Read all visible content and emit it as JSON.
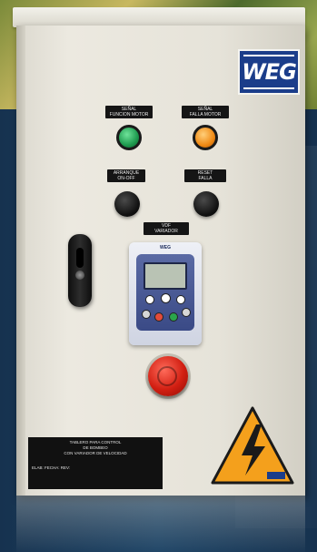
{
  "brand": {
    "logo_text": "WEG"
  },
  "labels": {
    "signal_run": [
      "SEÑAL",
      "FUNCION MOTOR"
    ],
    "signal_fault": [
      "SEÑAL",
      "FALLA MOTOR"
    ],
    "switch_onoff": [
      "ARRANQUE",
      "ON-OFF"
    ],
    "reset_fault": [
      "RESET",
      "FALLA"
    ],
    "vfd_label": [
      "VDF",
      "VARIADOR"
    ]
  },
  "vfd": {
    "brand": "WEG"
  },
  "info_plate": {
    "title_1": "TABLERO PARA CONTROL",
    "title_2": "DE BOMBEO",
    "subtitle": "CON VARIADOR DE VELOCIDAD",
    "row": "ELAB:   FECHA:   REV:"
  },
  "colors": {
    "lamp_green": "#1d9a4e",
    "lamp_orange": "#f08a14",
    "estop_red": "#d21f12",
    "warning_yellow": "#f4a01c",
    "logo_blue": "#1b3d8a"
  },
  "icons": [
    "run-indicator-lamp",
    "fault-indicator-lamp",
    "selector-knob",
    "door-handle",
    "emergency-stop",
    "high-voltage-warning-icon"
  ]
}
